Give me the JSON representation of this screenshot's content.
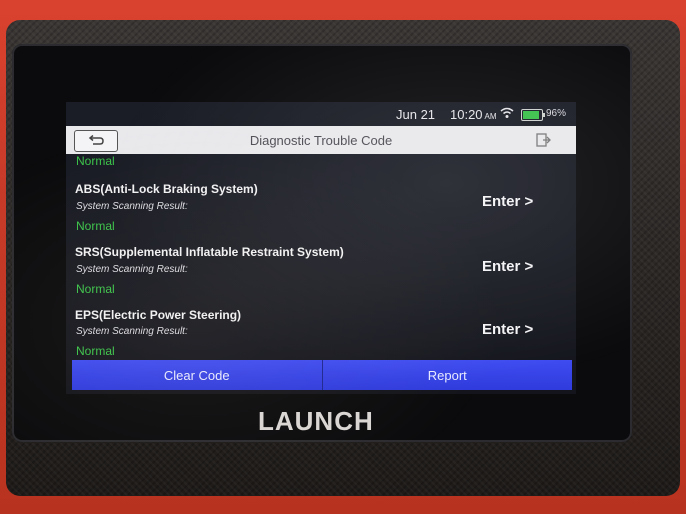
{
  "status_bar": {
    "date": "Jun 21",
    "time": "10:20",
    "ampm": "AM",
    "battery": "96%"
  },
  "header": {
    "title": "Diagnostic Trouble Code"
  },
  "partial_status": "Normal",
  "systems": [
    {
      "name": "ABS(Anti-Lock Braking System)",
      "result_label": "System Scanning Result:",
      "status": "Normal",
      "action": "Enter >"
    },
    {
      "name": "SRS(Supplemental Inflatable Restraint System)",
      "result_label": "System Scanning Result:",
      "status": "Normal",
      "action": "Enter >"
    },
    {
      "name": "EPS(Electric Power Steering)",
      "result_label": "System Scanning Result:",
      "status": "Normal",
      "action": "Enter >"
    }
  ],
  "footer": {
    "clear_label": "Clear Code",
    "report_label": "Report"
  },
  "brand": "LAUNCH",
  "colors": {
    "status_ok": "#3bc44a",
    "button_blue": "#3a46ea",
    "device_red": "#c73a28"
  }
}
